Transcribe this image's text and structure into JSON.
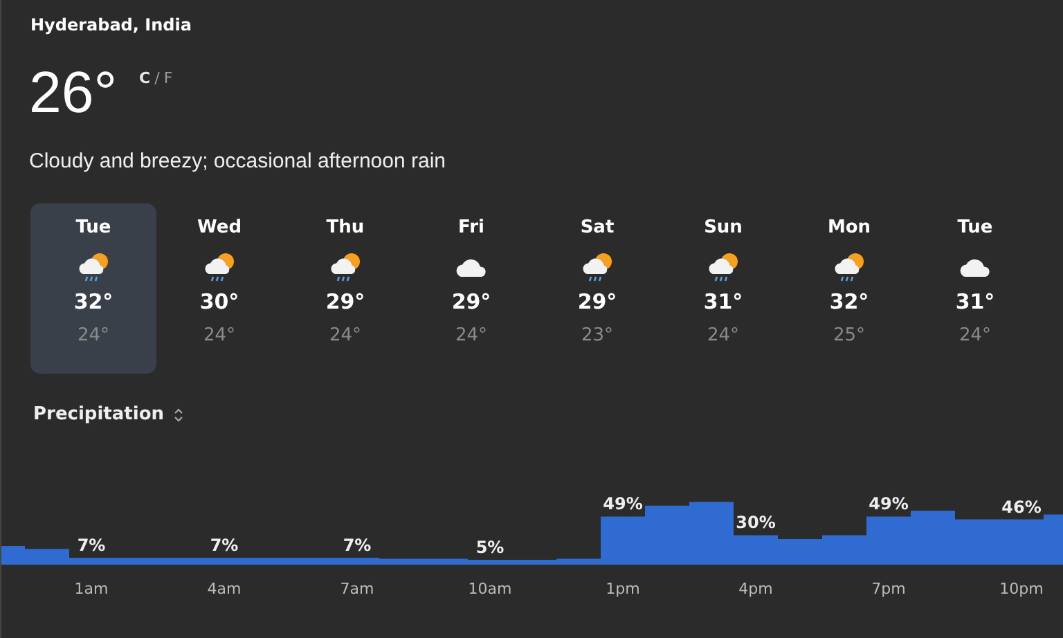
{
  "location": "Hyderabad, India",
  "current": {
    "temperature": "26°",
    "unit_c": "C",
    "unit_separator": "/",
    "unit_f": "F",
    "description": "Cloudy and breezy; occasional afternoon rain"
  },
  "days": [
    {
      "day": "Tue",
      "kind": "rain",
      "high": "32°",
      "low": "24°",
      "selected": true
    },
    {
      "day": "Wed",
      "kind": "rain",
      "high": "30°",
      "low": "24°",
      "selected": false
    },
    {
      "day": "Thu",
      "kind": "rain",
      "high": "29°",
      "low": "24°",
      "selected": false
    },
    {
      "day": "Fri",
      "kind": "cloudy",
      "high": "29°",
      "low": "24°",
      "selected": false
    },
    {
      "day": "Sat",
      "kind": "rain",
      "high": "29°",
      "low": "23°",
      "selected": false
    },
    {
      "day": "Sun",
      "kind": "rain",
      "high": "31°",
      "low": "24°",
      "selected": false
    },
    {
      "day": "Mon",
      "kind": "rain",
      "high": "32°",
      "low": "25°",
      "selected": false
    },
    {
      "day": "Tue",
      "kind": "cloudy",
      "high": "31°",
      "low": "24°",
      "selected": false
    }
  ],
  "precipitation": {
    "title": "Precipitation",
    "hours": [
      {
        "time": "1am",
        "chance": "7%"
      },
      {
        "time": "4am",
        "chance": "7%"
      },
      {
        "time": "7am",
        "chance": "7%"
      },
      {
        "time": "10am",
        "chance": "5%"
      },
      {
        "time": "1pm",
        "chance": "49%"
      },
      {
        "time": "4pm",
        "chance": "30%"
      },
      {
        "time": "7pm",
        "chance": "49%"
      },
      {
        "time": "10pm",
        "chance": "46%"
      }
    ]
  }
}
